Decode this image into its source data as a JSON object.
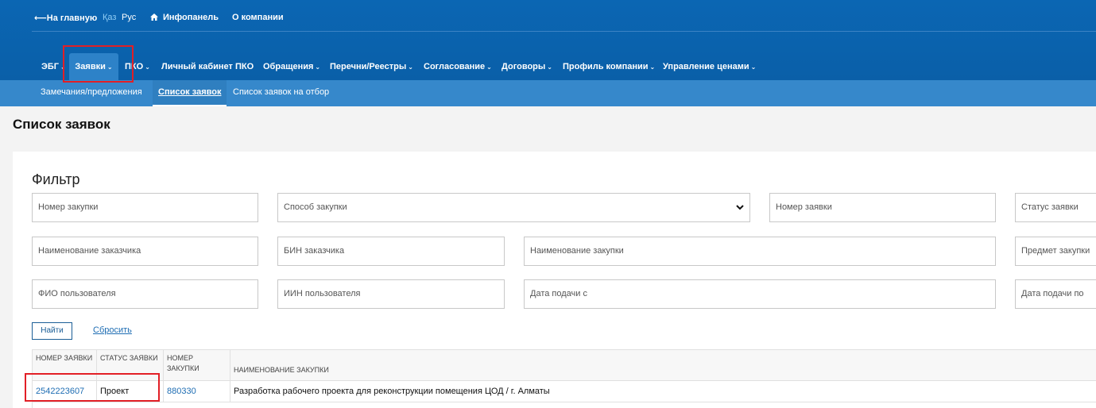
{
  "topbar": {
    "home_link": "⟵На главную",
    "lang_kz": "Қаз",
    "lang_ru": "Рус",
    "infopanel": "Инфопанель",
    "about": "О компании"
  },
  "nav": {
    "items": [
      {
        "label": "ЭБГ",
        "has_dropdown": true
      },
      {
        "label": "Заявки",
        "has_dropdown": true,
        "active": true
      },
      {
        "label": "ПКО",
        "has_dropdown": true
      },
      {
        "label": "Личный кабинет ПКО",
        "has_dropdown": false
      },
      {
        "label": "Обращения",
        "has_dropdown": true
      },
      {
        "label": "Перечни/Реестры",
        "has_dropdown": true
      },
      {
        "label": "Согласование",
        "has_dropdown": true
      },
      {
        "label": "Договоры",
        "has_dropdown": true
      },
      {
        "label": "Профиль компании",
        "has_dropdown": true
      },
      {
        "label": "Управление ценами",
        "has_dropdown": true
      }
    ],
    "chevron": "⌄"
  },
  "subnav": {
    "items": [
      {
        "label": "Замечания/предложения"
      },
      {
        "label": "Список заявок",
        "active": true
      },
      {
        "label": "Список заявок на отбор"
      }
    ]
  },
  "page": {
    "title": "Список заявок"
  },
  "filter": {
    "title": "Фильтр",
    "fields": {
      "purchase_number": "Номер закупки",
      "purchase_method": "Способ закупки",
      "application_number": "Номер заявки",
      "application_status": "Статус заявки",
      "customer_name": "Наименование заказчика",
      "customer_bin": "БИН заказчика",
      "purchase_name": "Наименование закупки",
      "purchase_subject": "Предмет закупки",
      "user_fio": "ФИО пользователя",
      "user_iin": "ИИН пользователя",
      "date_from": "Дата подачи с",
      "date_to": "Дата подачи по"
    },
    "find_button": "Найти",
    "reset_link": "Сбросить"
  },
  "table": {
    "headers": {
      "app_number": "Номер заявки",
      "status": "Статус заявки",
      "purchase_number": "Номер закупки",
      "purchase_name": "Наименование закупки"
    },
    "rows": [
      {
        "app_number": "2542223607",
        "status": "Проект",
        "purchase_number": "880330",
        "purchase_name": "Разработка рабочего проекта для реконструкции помещения ЦОД / г. Алматы"
      }
    ]
  },
  "colors": {
    "header_bg": "#0b66b3",
    "subnav_bg": "#3688cb",
    "link": "#1e6db3",
    "highlight": "#e21f26"
  }
}
